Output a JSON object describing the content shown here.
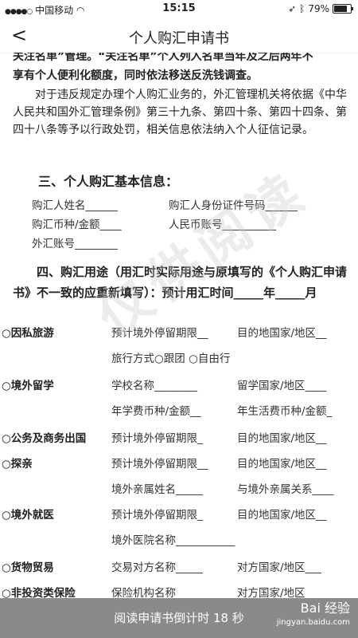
{
  "status": {
    "carrier": "中国移动",
    "time": "15:15",
    "battery": "79%"
  },
  "nav": {
    "back": "<",
    "title": "个人购汇申请书"
  },
  "intro": {
    "cut_line": "关注名单”管理。“关注名单”个人列入名单当年及之后两年不",
    "line2": "享有个人便利化额度，同时依法移送反洗钱调查。",
    "para": "对于违反规定办理个人购汇业务的，外汇管理机关将依据《中华人民共和国外汇管理条例》第三十九条、第四十条、第四十四条、第四十八条等予以行政处罚，相关信息依法纳入个人征信记录。"
  },
  "section3": {
    "heading": "三、个人购汇基本信息：",
    "fields": [
      "购汇人姓名______",
      "购汇人身份证件号码______",
      "购汇币种/金额____",
      "人民币账号__________",
      "外汇账号________"
    ]
  },
  "section4": {
    "heading": "四、购汇用途（用汇时实际用途与原填写的《个人购汇申请书》不一致的应重新填写）：预计用汇时间_____年_____月"
  },
  "purposes": [
    {
      "cat": "○因私旅游",
      "f1": "预计境外停留期限__",
      "f2": "目的地国家/地区__",
      "f3": "旅行方式○跟团 ○自由行",
      "f4": ""
    },
    {
      "cat": "○境外留学",
      "f1": "学校名称________",
      "f2": "留学国家/地区____",
      "f3": "年学费币种/金额__",
      "f4": "年生活费币种/金额_"
    },
    {
      "cat": "○公务及商务出国",
      "f1": "预计境外停留期限_",
      "f2": "目的地国家/地区__",
      "f3": "",
      "f4": ""
    },
    {
      "cat": "○探亲",
      "f1": "预计境外停留期限__",
      "f2": "目的地国家/地区__",
      "f3": "境外亲属姓名_____",
      "f4": "与境外亲属关系____"
    },
    {
      "cat": "○境外就医",
      "f1": "预计境外停留期限_",
      "f2": "目的地国家/地区__",
      "f3": "境外医院名称___________",
      "f4": ""
    },
    {
      "cat": "○货物贸易",
      "f1": "交易对方名称_____",
      "f2": "对方国家/地区___",
      "f3": "",
      "f4": ""
    },
    {
      "cat": "○非投资类保险",
      "f1": "保险机构名称_____",
      "f2": "对方国家/地区___",
      "f3": "",
      "f4": ""
    }
  ],
  "watermark": "仅供阅读",
  "footer": {
    "countdown": "阅读申请书倒计时  18 秒",
    "logo": "Bai 经验",
    "logo_sub": "jingyan.baidu.com"
  }
}
